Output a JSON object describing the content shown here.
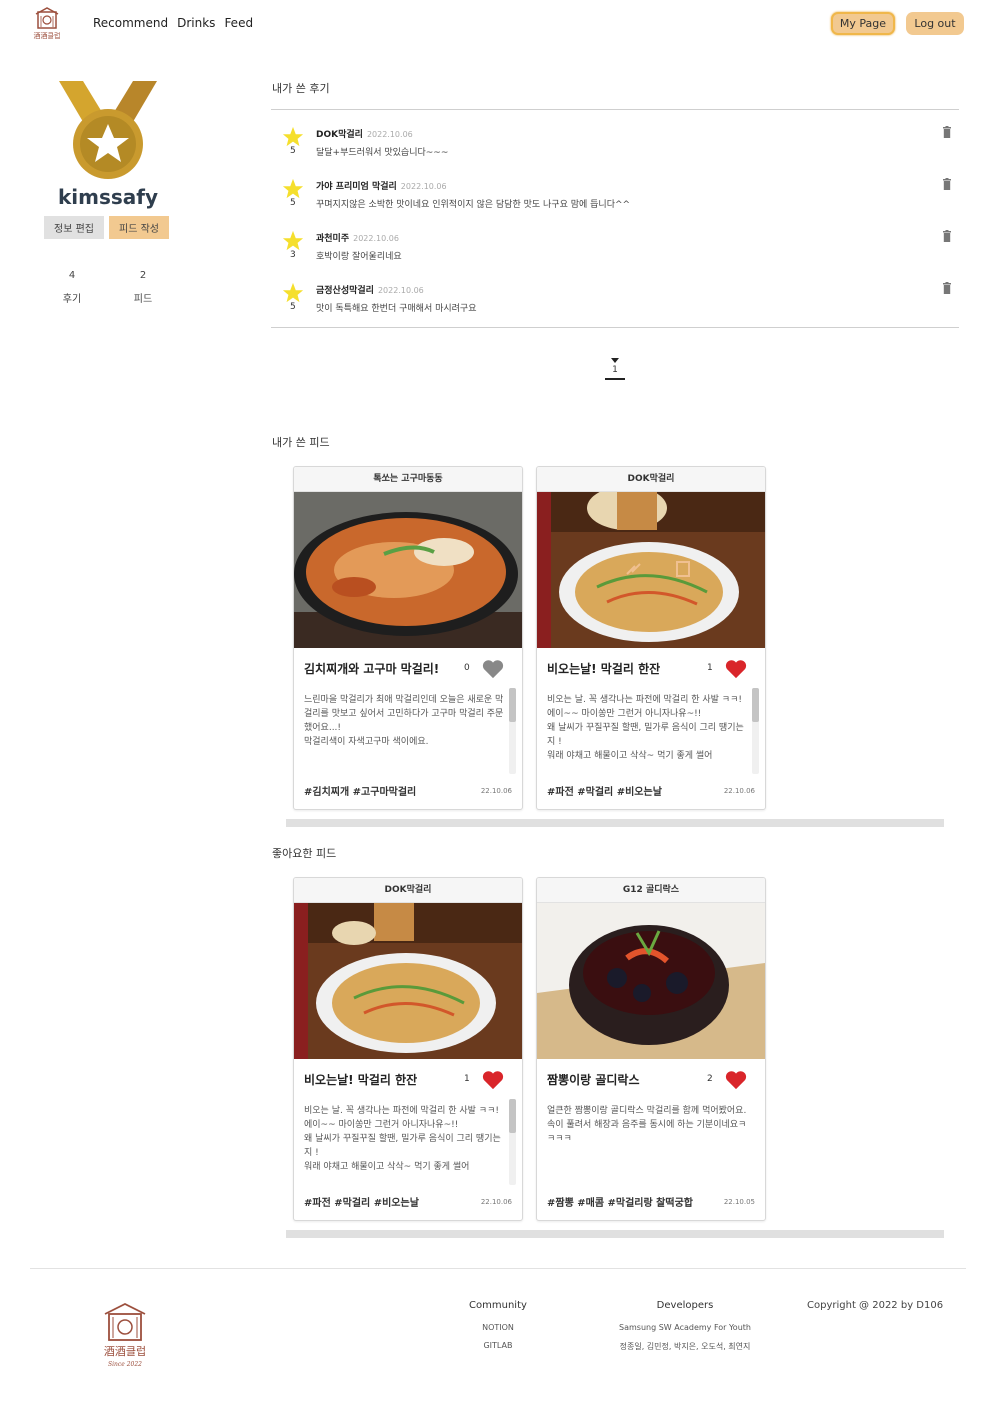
{
  "header": {
    "nav": [
      "Recommend",
      "Drinks",
      "Feed"
    ],
    "mypage_label": "My Page",
    "logout_label": "Log out",
    "logo_text": "酒酒클럽"
  },
  "profile": {
    "username": "kimssafy",
    "edit_label": "정보 편집",
    "write_label": "피드 작성",
    "stats": [
      {
        "num": "4",
        "label": "후기"
      },
      {
        "num": "2",
        "label": "피드"
      }
    ]
  },
  "reviews_section": {
    "title": "내가 쓴 후기",
    "items": [
      {
        "rating": "5",
        "name": "DOK막걸리",
        "date": "2022.10.06",
        "text": "달달+부드러워서 맛있습니다~~~"
      },
      {
        "rating": "5",
        "name": "가야 프리미엄 막걸리",
        "date": "2022.10.06",
        "text": "꾸며지지않은 소박한 맛이네요 인위적이지 않은 담담한 맛도 나구요 맘에 듭니다^^"
      },
      {
        "rating": "3",
        "name": "과천미주",
        "date": "2022.10.06",
        "text": "호박이랑 잘어울리네요"
      },
      {
        "rating": "5",
        "name": "금정산성막걸리",
        "date": "2022.10.06",
        "text": "맛이 독특해요 한번더 구매해서 마시려구요"
      }
    ],
    "page": "1"
  },
  "my_feeds": {
    "title": "내가 쓴 피드",
    "cards": [
      {
        "header": "톡쏘는 고구마동동",
        "title": "김치찌개와 고구마 막걸리!",
        "likes": "0",
        "liked": false,
        "body": [
          "느린마을 막걸리가 최애 막걸리인데 오늘은 새로운 막걸리를 맛보고 싶어서 고민하다가 고구마 막걸리 주문했어요...!",
          "",
          "막걸리색이 자색고구마 색이에요."
        ],
        "tags": "#김치찌개 #고구마막걸리",
        "date": "22.10.06"
      },
      {
        "header": "DOK막걸리",
        "title": "비오는날! 막걸리 한잔",
        "likes": "1",
        "liked": true,
        "body": [
          "비오는 날. 꼭 생각나는 파전에 막걸리 한 사발 ㅋㅋ! 에이~~ 마이쏭만 그런거 아니자나유~!!",
          "왜 날씨가 꾸질꾸질 할땐, 밀가루 음식이 그리 땡기는지 !",
          "워래 야채고 해물이고 삭삭~ 먹기 좋게 썰어"
        ],
        "tags": "#파전 #막걸리 #비오는날",
        "date": "22.10.06"
      }
    ]
  },
  "liked_feeds": {
    "title": "좋아요한 피드",
    "cards": [
      {
        "header": "DOK막걸리",
        "title": "비오는날! 막걸리 한잔",
        "likes": "1",
        "liked": true,
        "body": [
          "비오는 날. 꼭 생각나는 파전에 막걸리 한 사발 ㅋㅋ! 에이~~ 마이쏭만 그런거 아니자나유~!!",
          "왜 날씨가 꾸질꾸질 할땐, 밀가루 음식이 그리 땡기는지 !",
          "워래 야채고 해물이고 삭삭~ 먹기 좋게 썰어"
        ],
        "tags": "#파전 #막걸리 #비오는날",
        "date": "22.10.06"
      },
      {
        "header": "G12 골디락스",
        "title": "짬뽕이랑 골디락스",
        "likes": "2",
        "liked": true,
        "body": [
          "얼큰한 짬뽕이랑 골디락스 막걸리를 함께 먹어봤어요.",
          "속이 풀려서 해장과 음주를 동시에 하는 기분이네요ㅋㅋㅋㅋ"
        ],
        "tags": "#짬뽕 #매콤 #막걸리랑 찰떡궁합",
        "date": "22.10.05"
      }
    ]
  },
  "footer": {
    "logo_text": "酒酒클럽",
    "logo_subtext": "Since 2022",
    "community_head": "Community",
    "community_items": [
      "NOTION",
      "GITLAB"
    ],
    "developers_head": "Developers",
    "developers_items": [
      "Samsung SW Academy For Youth",
      "정종일, 김민정, 박지은, 오도석, 최연지"
    ],
    "copyright": "Copyright @ 2022 by D106"
  },
  "colors": {
    "accent": "#f2c990",
    "heart": "#d9252a",
    "heart_off": "#888888",
    "star": "#f5df2d",
    "medal": "#c99a2e"
  },
  "icons": [
    "logo-icon",
    "medal-icon",
    "star-icon",
    "trash-icon",
    "heart-icon",
    "chevron-down-icon"
  ]
}
